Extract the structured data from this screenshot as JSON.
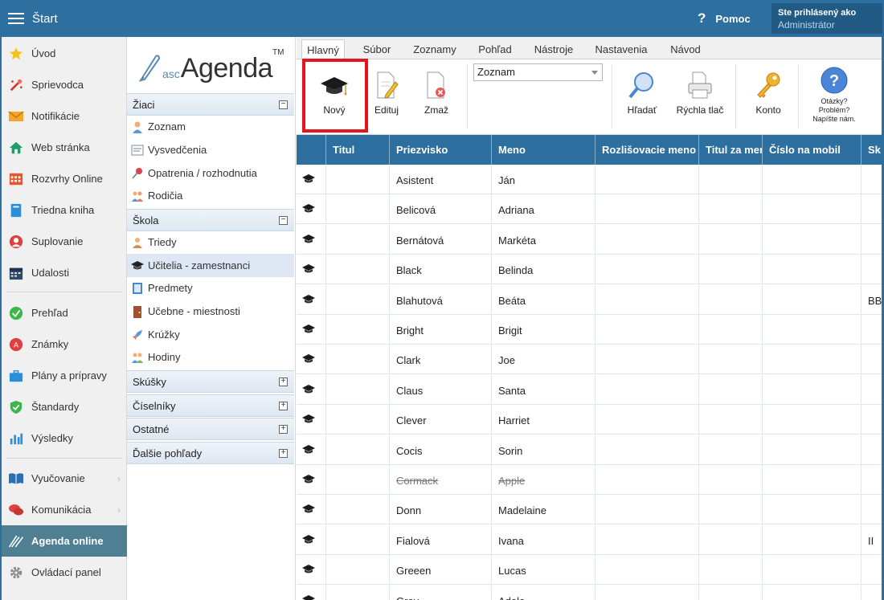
{
  "topbar": {
    "title": "Štart",
    "help_label": "Pomoc",
    "user_line1": "Ste prihlásený ako",
    "user_line2": "Administrátor"
  },
  "sidebar": {
    "items": [
      {
        "label": "Úvod",
        "icon": "star-icon"
      },
      {
        "label": "Sprievodca",
        "icon": "wand-icon"
      },
      {
        "label": "Notifikácie",
        "icon": "envelope-icon"
      },
      {
        "label": "Web stránka",
        "icon": "home-icon"
      },
      {
        "label": "Rozvrhy Online",
        "icon": "calendar-grid-icon"
      },
      {
        "label": "Triedna kniha",
        "icon": "book-icon"
      },
      {
        "label": "Suplovanie",
        "icon": "person-icon"
      },
      {
        "label": "Udalosti",
        "icon": "calendar-icon"
      },
      {
        "label": "Prehľad",
        "icon": "check-circle-icon"
      },
      {
        "label": "Známky",
        "icon": "grade-icon"
      },
      {
        "label": "Plány a prípravy",
        "icon": "briefcase-icon"
      },
      {
        "label": "Štandardy",
        "icon": "shield-check-icon"
      },
      {
        "label": "Výsledky",
        "icon": "bar-chart-icon"
      },
      {
        "label": "Vyučovanie",
        "icon": "open-book-icon"
      },
      {
        "label": "Komunikácia",
        "icon": "chat-icon"
      },
      {
        "label": "Agenda online",
        "icon": "agenda-logo-icon"
      },
      {
        "label": "Ovládací panel",
        "icon": "gear-icon"
      }
    ]
  },
  "logo": {
    "prefix": "asc",
    "name": "Agenda",
    "tm": "TM"
  },
  "nav": {
    "sections": [
      {
        "label": "Žiaci",
        "expanded": true
      },
      {
        "label": "Škola",
        "expanded": true
      },
      {
        "label": "Skúšky",
        "expanded": false
      },
      {
        "label": "Číselníky",
        "expanded": false
      },
      {
        "label": "Ostatné",
        "expanded": false
      },
      {
        "label": "Ďalšie pohľady",
        "expanded": false
      }
    ],
    "ziaci_items": [
      "Zoznam",
      "Vysvedčenia",
      "Opatrenia / rozhodnutia",
      "Rodičia"
    ],
    "skola_items": [
      "Triedy",
      "Učitelia - zamestnanci",
      "Predmety",
      "Učebne - miestnosti",
      "Krúžky",
      "Hodiny"
    ],
    "collapse_symbol": "−",
    "expand_symbol": "+"
  },
  "ribbon": {
    "tabs": [
      "Hlavný",
      "Súbor",
      "Zoznamy",
      "Pohľad",
      "Nástroje",
      "Nastavenia",
      "Návod"
    ],
    "buttons": {
      "new": "Nový",
      "edit": "Edituj",
      "delete": "Zmaž",
      "search": "Hľadať",
      "quick_print": "Rýchla tlač",
      "account": "Konto",
      "help1": "Otázky?",
      "help2": "Problém?",
      "help3": "Napíšte nám."
    },
    "view_select": "Zoznam"
  },
  "grid": {
    "columns": [
      "Titul",
      "Priezvisko",
      "Meno",
      "Rozlišovacie meno",
      "Titul za menom",
      "Číslo na mobil",
      "Sk"
    ],
    "rows": [
      {
        "titul": "",
        "priezvisko": "Asistent",
        "meno": "Ján",
        "extra": ""
      },
      {
        "titul": "",
        "priezvisko": "Belicová",
        "meno": "Adriana",
        "extra": ""
      },
      {
        "titul": "",
        "priezvisko": "Bernátová",
        "meno": "Markéta",
        "extra": ""
      },
      {
        "titul": "",
        "priezvisko": "Black",
        "meno": "Belinda",
        "extra": ""
      },
      {
        "titul": "",
        "priezvisko": "Blahutová",
        "meno": "Beáta",
        "extra": "BB"
      },
      {
        "titul": "",
        "priezvisko": "Bright",
        "meno": "Brigit",
        "extra": ""
      },
      {
        "titul": "",
        "priezvisko": "Clark",
        "meno": "Joe",
        "extra": ""
      },
      {
        "titul": "",
        "priezvisko": "Claus",
        "meno": "Santa",
        "extra": ""
      },
      {
        "titul": "",
        "priezvisko": "Clever",
        "meno": "Harriet",
        "extra": ""
      },
      {
        "titul": "",
        "priezvisko": "Cocis",
        "meno": "Sorin",
        "extra": ""
      },
      {
        "titul": "",
        "priezvisko": "Cormack",
        "meno": "Apple",
        "extra": "",
        "inactive": true
      },
      {
        "titul": "",
        "priezvisko": "Donn",
        "meno": "Madelaine",
        "extra": ""
      },
      {
        "titul": "",
        "priezvisko": "Fialová",
        "meno": "Ivana",
        "extra": "II"
      },
      {
        "titul": "",
        "priezvisko": "Greeen",
        "meno": "Lucas",
        "extra": ""
      },
      {
        "titul": "",
        "priezvisko": "Grey",
        "meno": "Adele",
        "extra": ""
      }
    ]
  },
  "colors": {
    "brand": "#2d6f9e",
    "highlight": "#e8141b",
    "active_sidebar": "#4f7f93"
  }
}
